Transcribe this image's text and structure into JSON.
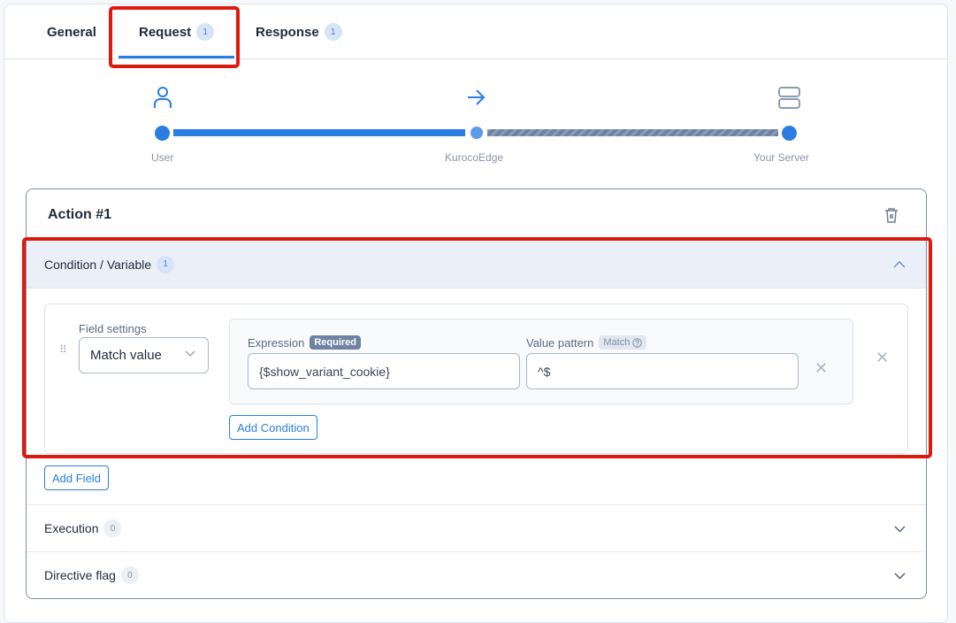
{
  "tabs": [
    {
      "label": "General",
      "badge": null,
      "active": false
    },
    {
      "label": "Request",
      "badge": "1",
      "active": true
    },
    {
      "label": "Response",
      "badge": "1",
      "active": false
    }
  ],
  "flow": {
    "nodes": [
      {
        "label": "User",
        "icon": "user-icon"
      },
      {
        "label": "KurocoEdge",
        "icon": "arrow-right-icon"
      },
      {
        "label": "Your Server",
        "icon": "server-icon"
      }
    ]
  },
  "action": {
    "title": "Action #1",
    "condition_section": {
      "label": "Condition / Variable",
      "badge": "1",
      "field": {
        "settings_label": "Field settings",
        "settings_value": "Match value",
        "expression_label": "Expression",
        "expression_required": "Required",
        "expression_value": "{$show_variant_cookie}",
        "pattern_label": "Value pattern",
        "pattern_tag": "Match",
        "pattern_value": "^$",
        "add_condition": "Add Condition"
      },
      "add_field": "Add Field"
    },
    "execution": {
      "label": "Execution",
      "badge": "0"
    },
    "directive": {
      "label": "Directive flag",
      "badge": "0"
    }
  },
  "colors": {
    "accent": "#2b7de1",
    "highlight": "#e0190f"
  }
}
